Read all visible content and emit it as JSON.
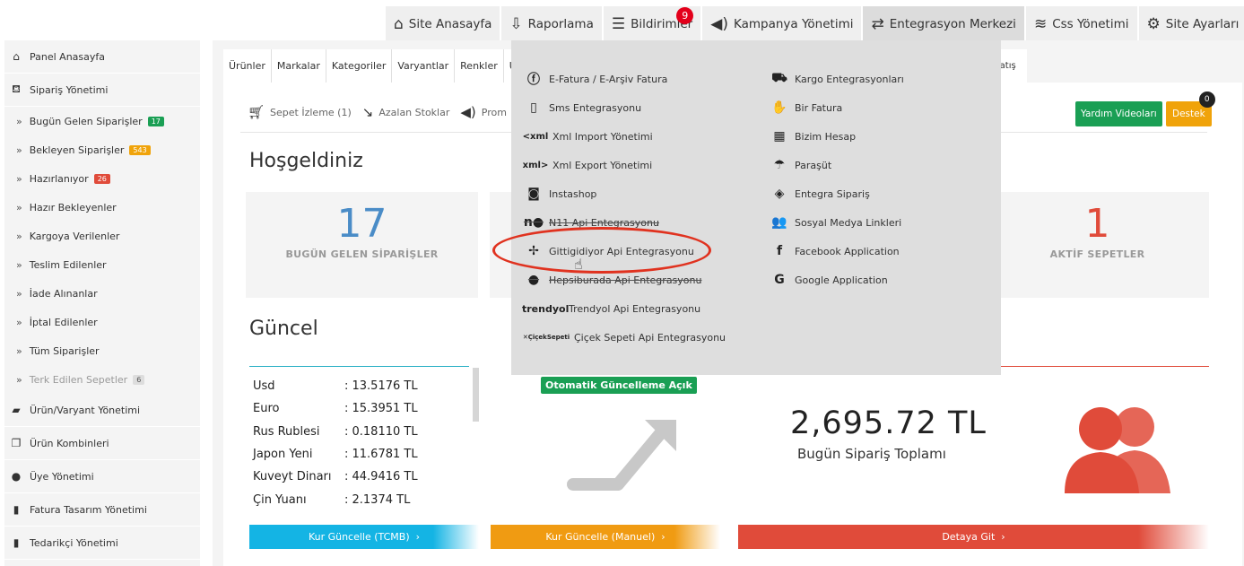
{
  "topnav": {
    "items": [
      {
        "icon": "home-icon",
        "label": "Site Anasayfa"
      },
      {
        "icon": "report-icon",
        "label": "Raporlama"
      },
      {
        "icon": "list-icon",
        "label": "Bildirimler",
        "badge": "9"
      },
      {
        "icon": "megaphone-icon",
        "label": "Kampanya Yönetimi"
      },
      {
        "icon": "exchange-icon",
        "label": "Entegrasyon Merkezi"
      },
      {
        "icon": "layers-icon",
        "label": "Css Yönetimi"
      },
      {
        "icon": "gear-icon",
        "label": "Site Ayarları"
      }
    ]
  },
  "sidebar": {
    "items": [
      {
        "type": "main",
        "icon": "home-icon",
        "label": "Panel Anasayfa"
      },
      {
        "type": "main",
        "icon": "basket-icon",
        "label": "Sipariş Yönetimi"
      },
      {
        "type": "sub",
        "label": "Bugün Gelen Siparişler",
        "count": "17",
        "color": "green"
      },
      {
        "type": "sub",
        "label": "Bekleyen Siparişler",
        "count": "543",
        "color": "orange"
      },
      {
        "type": "sub",
        "label": "Hazırlanıyor",
        "count": "26",
        "color": "red"
      },
      {
        "type": "sub",
        "label": "Hazır Bekleyenler"
      },
      {
        "type": "sub",
        "label": "Kargoya Verilenler"
      },
      {
        "type": "sub",
        "label": "Teslim Edilenler"
      },
      {
        "type": "sub",
        "label": "İade Alınanlar"
      },
      {
        "type": "sub",
        "label": "İptal Edilenler"
      },
      {
        "type": "sub",
        "label": "Tüm Siparişler"
      },
      {
        "type": "sub",
        "label": "Terk Edilen Sepetler",
        "count": "6",
        "color": "grey",
        "muted": true
      },
      {
        "type": "main",
        "icon": "bag-icon",
        "label": "Ürün/Varyant Yönetimi"
      },
      {
        "type": "main",
        "icon": "copy-icon",
        "label": "Ürün Kombinleri"
      },
      {
        "type": "main",
        "icon": "user-icon",
        "label": "Üye Yönetimi"
      },
      {
        "type": "main",
        "icon": "book-icon",
        "label": "Fatura Tasarım Yönetimi"
      },
      {
        "type": "main",
        "icon": "book-icon",
        "label": "Tedarikçi Yönetimi"
      }
    ]
  },
  "tabs": [
    "Ürünler",
    "Markalar",
    "Kategoriler",
    "Varyantlar",
    "Renkler",
    "Ü"
  ],
  "tab_right": "ın Satış",
  "subtools": [
    {
      "icon": "cart-icon",
      "label": "Sepet İzleme (1)"
    },
    {
      "icon": "trend-down-icon",
      "label": "Azalan Stoklar"
    },
    {
      "icon": "megaphone-icon",
      "label": "Prom"
    }
  ],
  "buttons": {
    "help": "Yardım Videoları",
    "support": "Destek",
    "support_badge": "0"
  },
  "welcome": "Hoşgeldiniz",
  "stats": {
    "today_orders": {
      "value": "17",
      "label": "BUGÜN GELEN SİPARİŞLER"
    },
    "active_carts": {
      "value": "1",
      "label": "AKTİF SEPETLER"
    }
  },
  "current_title": "Güncel",
  "rates": [
    {
      "currency": "Usd",
      "value": ": 13.5176 TL"
    },
    {
      "currency": "Euro",
      "value": ": 15.3951 TL"
    },
    {
      "currency": "Rus Rublesi",
      "value": ": 0.18110 TL"
    },
    {
      "currency": "Japon Yeni",
      "value": ": 11.6781 TL"
    },
    {
      "currency": "Kuveyt Dinarı",
      "value": ": 44.9416 TL"
    },
    {
      "currency": "Çin Yuanı",
      "value": ": 2.1374 TL"
    }
  ],
  "auto_update": "Otomatik Güncelleme Açık",
  "total": {
    "value": "2,695.72 TL",
    "label": "Bugün Sipariş Toplamı"
  },
  "bars": {
    "tcmb": "Kur Güncelle (TCMB)",
    "manuel": "Kur Güncelle (Manuel)",
    "detay": "Detaya Git"
  },
  "dropdown": {
    "left": [
      {
        "icon": "efatura-icon",
        "glyph": "ⓕ",
        "label": "E-Fatura / E-Arşiv Fatura"
      },
      {
        "icon": "sms-icon",
        "glyph": "▯",
        "label": "Sms Entegrasyonu"
      },
      {
        "icon": "xml-import-icon",
        "glyph": "<xml",
        "label": "Xml Import Yönetimi",
        "text": true
      },
      {
        "icon": "xml-export-icon",
        "glyph": "xml>",
        "label": "Xml Export Yönetimi",
        "text": true
      },
      {
        "icon": "instagram-icon",
        "glyph": "◙",
        "label": "Instashop"
      },
      {
        "icon": "n11-icon",
        "glyph": "n●",
        "label": "N11 Api Entegrasyonu",
        "struck": true
      },
      {
        "icon": "gittigidiyor-icon",
        "glyph": "✢",
        "label": "Gittigidiyor Api Entegrasyonu"
      },
      {
        "icon": "hepsiburada-icon",
        "glyph": "●",
        "label": "Hepsiburada Api Entegrasyonu",
        "struck": true
      },
      {
        "icon": "trendyol-icon",
        "glyph": "trendyol",
        "label": "Trendyol Api Entegrasyonu",
        "trend": true
      },
      {
        "icon": "ciceksepeti-icon",
        "glyph": "✕ÇiçekSepeti",
        "label": "Çiçek Sepeti Api Entegrasyonu",
        "cicek": true
      }
    ],
    "right": [
      {
        "icon": "truck-icon",
        "glyph": "⛟",
        "label": "Kargo Entegrasyonları"
      },
      {
        "icon": "birfatura-icon",
        "glyph": "✋",
        "label": "Bir Fatura"
      },
      {
        "icon": "calculator-icon",
        "glyph": "▦",
        "label": "Bizim Hesap"
      },
      {
        "icon": "parasut-icon",
        "glyph": "☂",
        "label": "Paraşüt"
      },
      {
        "icon": "entegra-icon",
        "glyph": "◈",
        "label": "Entegra Sipariş"
      },
      {
        "icon": "users-icon",
        "glyph": "👥",
        "label": "Sosyal Medya Linkleri"
      },
      {
        "icon": "facebook-icon",
        "glyph": "f",
        "label": "Facebook Application"
      },
      {
        "icon": "google-icon",
        "glyph": "G",
        "label": "Google Application"
      }
    ]
  }
}
